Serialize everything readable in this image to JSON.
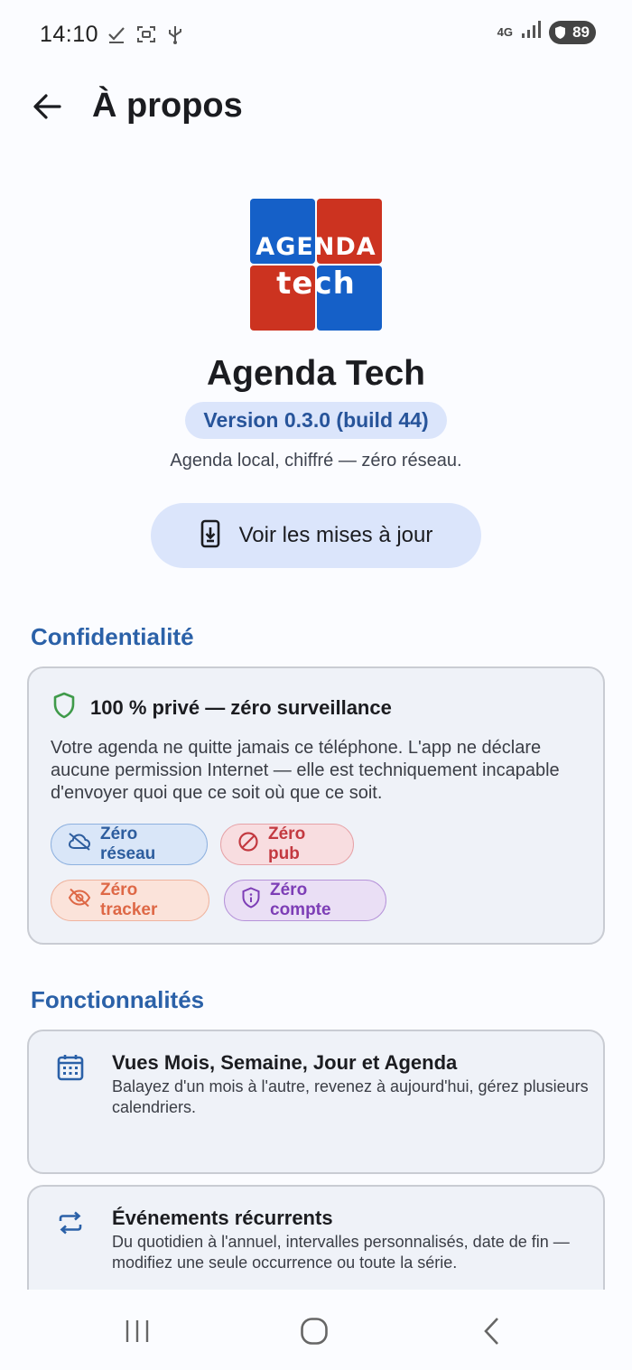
{
  "status_bar": {
    "time": "14:10",
    "network": "4G",
    "battery": "89"
  },
  "app_bar": {
    "title": "À propos"
  },
  "header": {
    "logo_line1": "AGENDA",
    "logo_line2": "tech",
    "app_name": "Agenda Tech",
    "version": "Version 0.3.0 (build 44)",
    "tagline": "Agenda local, chiffré — zéro réseau.",
    "update_button": "Voir les mises à jour"
  },
  "privacy": {
    "section_title": "Confidentialité",
    "card_title": "100 % privé — zéro surveillance",
    "card_body": "Votre agenda ne quitte jamais ce téléphone. L'app ne déclare aucune permission Internet — elle est techniquement incapable d'envoyer quoi que ce soit où que ce soit.",
    "chips": {
      "network": "Zéro réseau",
      "ads": "Zéro pub",
      "tracker": "Zéro tracker",
      "account": "Zéro compte"
    }
  },
  "features": {
    "section_title": "Fonctionnalités",
    "items": [
      {
        "icon": "calendar-icon",
        "title": "Vues Mois, Semaine, Jour et Agenda",
        "desc": "Balayez d'un mois à l'autre, revenez à aujourd'hui, gérez plusieurs calendriers."
      },
      {
        "icon": "repeat-icon",
        "title": "Événements récurrents",
        "desc": "Du quotidien à l'annuel, intervalles personnalisés, date de fin — modifiez une seule occurrence ou toute la série."
      }
    ]
  },
  "colors": {
    "accent": "#2b61a8",
    "chip_network": "#2d5d9e",
    "chip_ads": "#c33940",
    "chip_tracker": "#de6846",
    "chip_account": "#7d3eb6",
    "shield_green": "#3f9a4a"
  }
}
